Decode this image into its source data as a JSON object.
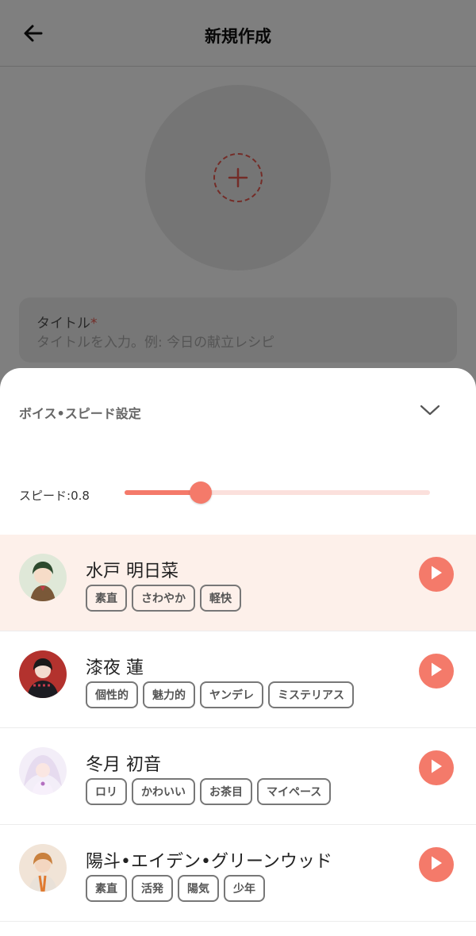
{
  "header": {
    "title": "新規作成",
    "back_icon": "arrow-left-icon"
  },
  "image_picker": {
    "icon": "plus-icon"
  },
  "title_field": {
    "label": "タイトル",
    "required_mark": "*",
    "placeholder": "タイトルを入力。例: 今日の献立レシピ",
    "value": ""
  },
  "sheet": {
    "title": "ボイス•スピード設定",
    "collapse_icon": "chevron-down-icon",
    "speed": {
      "label": "スピード:",
      "value": "0.8",
      "fraction": 0.25
    },
    "voices": [
      {
        "name": "水戸 明日菜",
        "tags": [
          "素直",
          "さわやか",
          "軽快"
        ],
        "selected": true
      },
      {
        "name": "漆夜 蓮",
        "tags": [
          "個性的",
          "魅力的",
          "ヤンデレ",
          "ミステリアス"
        ],
        "selected": false
      },
      {
        "name": "冬月 初音",
        "tags": [
          "ロリ",
          "かわいい",
          "お茶目",
          "マイペース"
        ],
        "selected": false
      },
      {
        "name": "陽斗•エイデン•グリーンウッド",
        "tags": [
          "素直",
          "活発",
          "陽気",
          "少年"
        ],
        "selected": false
      }
    ]
  },
  "colors": {
    "accent": "#f47a6a",
    "selected_row": "#fdf0ea",
    "required": "#e8584e"
  }
}
